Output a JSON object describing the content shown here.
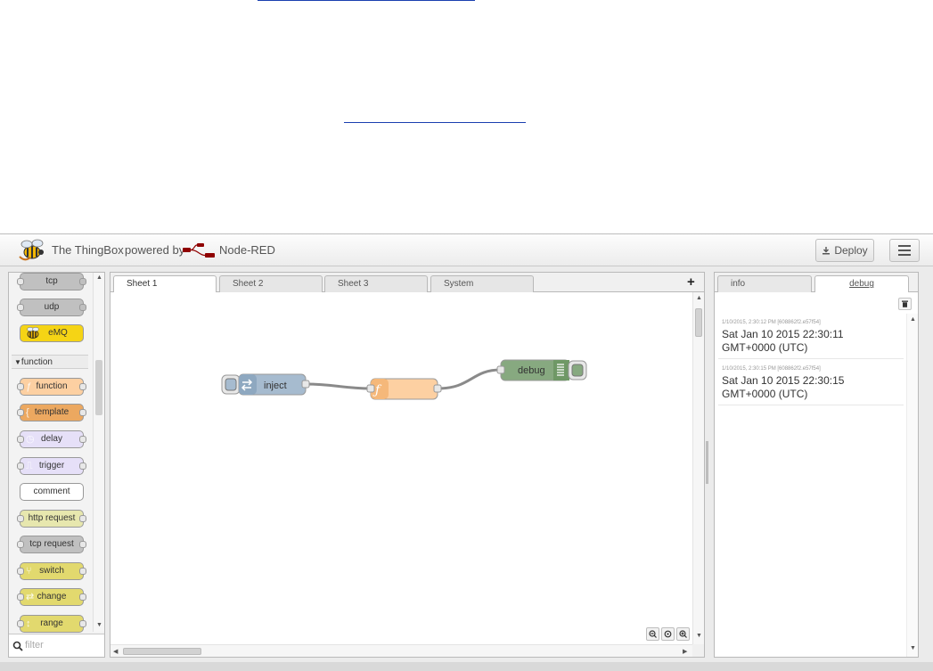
{
  "header": {
    "app_title": "The ThingBox",
    "powered_by": "powered by",
    "brand": "Node-RED",
    "deploy_label": "Deploy"
  },
  "palette": {
    "top_nodes": [
      {
        "label": "tcp",
        "color": "#c0c0c0"
      },
      {
        "label": "udp",
        "color": "#c0c0c0"
      },
      {
        "label": "eMQ",
        "color": "#f5d415"
      }
    ],
    "category": "function",
    "function_nodes": [
      {
        "label": "function",
        "color": "#fdd0a2",
        "icon": "function-icon"
      },
      {
        "label": "template",
        "color": "#eca860",
        "icon": "template-icon"
      },
      {
        "label": "delay",
        "color": "#e6e0f8",
        "icon": "timer-icon"
      },
      {
        "label": "trigger",
        "color": "#e6e0f8",
        "icon": "trigger-icon"
      },
      {
        "label": "comment",
        "color": "#ffffff",
        "icon": ""
      },
      {
        "label": "http request",
        "color": "#e7e7ae",
        "icon": "white-globe-icon"
      },
      {
        "label": "tcp request",
        "color": "#c0c0c0",
        "icon": "bridge-icon"
      },
      {
        "label": "switch",
        "color": "#e2d96e",
        "icon": "switch-icon"
      },
      {
        "label": "change",
        "color": "#e2d96e",
        "icon": "swap-icon"
      },
      {
        "label": "range",
        "color": "#e2d96e",
        "icon": "range-icon"
      }
    ],
    "filter_placeholder": "filter"
  },
  "workspace": {
    "tabs": [
      "Sheet 1",
      "Sheet 2",
      "Sheet 3",
      "System"
    ],
    "active_tab": "Sheet 1",
    "nodes": [
      {
        "label": "inject",
        "type": "inject",
        "color": "#a6bbcf"
      },
      {
        "label": "",
        "type": "function",
        "color": "#fdd0a2"
      },
      {
        "label": "debug",
        "type": "debug",
        "color": "#87a980"
      }
    ]
  },
  "sidebar": {
    "tabs": [
      "info",
      "debug"
    ],
    "active_tab": "debug",
    "messages": [
      {
        "meta": "1/10/2015, 2:30:12 PM   [608862f2.e57f54]",
        "payload": "Sat Jan 10 2015 22:30:11 GMT+0000 (UTC)"
      },
      {
        "meta": "1/10/2015, 2:30:15 PM   [608862f2.e57f54]",
        "payload": "Sat Jan 10 2015 22:30:15 GMT+0000 (UTC)"
      }
    ]
  }
}
